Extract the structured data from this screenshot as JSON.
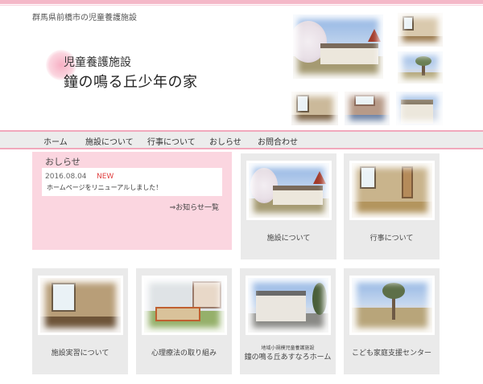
{
  "header": {
    "caption": "群馬県前橋市の児童養護施設",
    "logo_sub": "児童養護施設",
    "logo_title": "鐘の鳴る丘少年の家"
  },
  "nav": {
    "items": [
      "ホーム",
      "施設について",
      "行事について",
      "おしらせ",
      "お問合わせ"
    ]
  },
  "news": {
    "title": "おしらせ",
    "date": "2016.08.04",
    "badge": "NEW",
    "text": "ホームページをリニューアルしました！",
    "more_link": "⇒お知らせ一覧"
  },
  "cards": [
    {
      "label": "施設について"
    },
    {
      "label": "行事について"
    },
    {
      "label": "施設実習について"
    },
    {
      "label": "心理療法の取り組み"
    },
    {
      "small": "地域小規模児童養護施設",
      "label": "鐘の鳴る丘あすなろホーム"
    },
    {
      "label": "こども家庭支援センター"
    }
  ],
  "colors": {
    "accent_pink": "#f1a8bc",
    "news_bg": "#fbd6e0",
    "card_bg": "#eaeaea",
    "new_badge": "#e04040"
  }
}
